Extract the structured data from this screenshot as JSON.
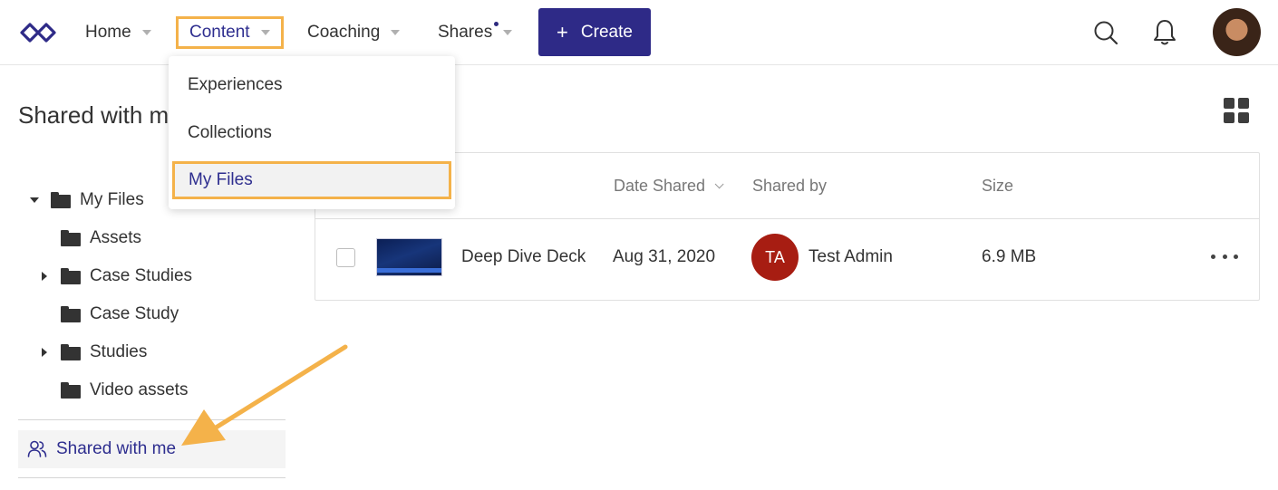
{
  "nav": {
    "home": "Home",
    "content": "Content",
    "coaching": "Coaching",
    "shares": "Shares",
    "create": "Create",
    "create_symbol": "+"
  },
  "dropdown": {
    "items": [
      "Experiences",
      "Collections",
      "My Files"
    ],
    "selected": "My Files"
  },
  "page": {
    "title": "Shared with me"
  },
  "sidebar": {
    "root": "My Files",
    "folders": [
      "Assets",
      "Case Studies",
      "Case Study",
      "Studies",
      "Video assets"
    ],
    "shared_with_me": "Shared with me"
  },
  "table": {
    "headers": {
      "date_shared": "Date Shared",
      "shared_by": "Shared by",
      "size": "Size"
    },
    "rows": [
      {
        "name": "Deep Dive Deck",
        "date_shared": "Aug 31, 2020",
        "sharer_initials": "TA",
        "shared_by": "Test Admin",
        "size": "6.9 MB"
      }
    ]
  },
  "colors": {
    "brand": "#2e2a87",
    "highlight": "#f4b24a",
    "avatar_ta": "#a71d12"
  },
  "icons": [
    "logo-infinity-icon",
    "search-icon",
    "bell-icon",
    "grid-view-icon",
    "folder-icon",
    "shared-users-icon",
    "more-icon"
  ]
}
